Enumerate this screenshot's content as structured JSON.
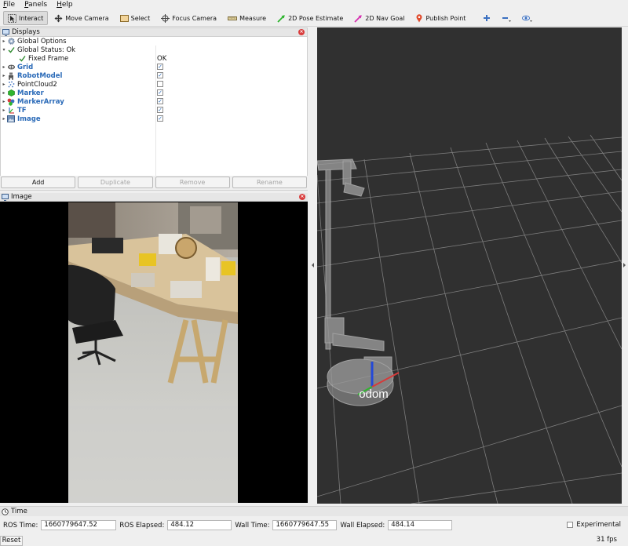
{
  "menu": {
    "file": "File",
    "panels": "Panels",
    "help": "Help"
  },
  "toolbar": {
    "interact": "Interact",
    "move_camera": "Move Camera",
    "select": "Select",
    "focus_camera": "Focus Camera",
    "measure": "Measure",
    "pose_estimate": "2D Pose Estimate",
    "nav_goal": "2D Nav Goal",
    "publish_point": "Publish Point"
  },
  "displays": {
    "title": "Displays",
    "items": [
      {
        "label": "Global Options",
        "arrow": "▸",
        "icon": "gear-icon"
      },
      {
        "label": "Global Status: Ok",
        "arrow": "▾",
        "icon": "check-icon"
      },
      {
        "label": "Fixed Frame",
        "value": "OK",
        "icon": "check-icon"
      },
      {
        "label": "Grid",
        "checked": true,
        "icon": "grid-icon"
      },
      {
        "label": "RobotModel",
        "checked": true,
        "icon": "robot-icon"
      },
      {
        "label": "PointCloud2",
        "checked": false,
        "icon": "pointcloud-icon"
      },
      {
        "label": "Marker",
        "checked": true,
        "icon": "marker-icon"
      },
      {
        "label": "MarkerArray",
        "checked": true,
        "icon": "markerarray-icon"
      },
      {
        "label": "TF",
        "checked": true,
        "icon": "tf-icon"
      },
      {
        "label": "Image",
        "checked": true,
        "icon": "image-icon"
      }
    ],
    "buttons": {
      "add": "Add",
      "duplicate": "Duplicate",
      "remove": "Remove",
      "rename": "Rename"
    }
  },
  "image_panel": {
    "title": "Image"
  },
  "view3d": {
    "frame_label": "odom"
  },
  "time_panel": {
    "title": "Time",
    "ros_time_label": "ROS Time:",
    "ros_time": "1660779647.52",
    "ros_elapsed_label": "ROS Elapsed:",
    "ros_elapsed": "484.12",
    "wall_time_label": "Wall Time:",
    "wall_time": "1660779647.55",
    "wall_elapsed_label": "Wall Elapsed:",
    "wall_elapsed": "484.14",
    "experimental": "Experimental",
    "reset": "Reset",
    "fps": "31 fps"
  },
  "colors": {
    "accent_blue": "#2a6ab8",
    "grid_bg": "#303030",
    "close_red": "#d93c3c"
  }
}
